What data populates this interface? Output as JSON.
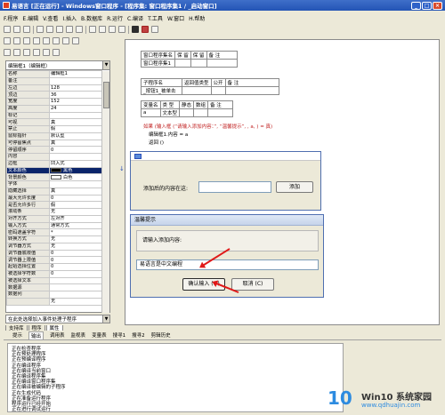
{
  "window": {
    "title": "易语言 [正在运行] - Windows窗口程序 - [程序集: 窗口程序集1 / _启动窗口]"
  },
  "menu": [
    "F.程序",
    "E.编辑",
    "V.查看",
    "I.插入",
    "B.数据库",
    "R.运行",
    "C.编译",
    "T.工具",
    "W.窗口",
    "H.帮助"
  ],
  "properties": {
    "combo": "编辑框1（编辑框）",
    "rows": [
      {
        "k": "名称",
        "v": "编辑框1"
      },
      {
        "k": "备注",
        "v": ""
      },
      {
        "k": "左边",
        "v": "128"
      },
      {
        "k": "顶边",
        "v": "36"
      },
      {
        "k": "宽度",
        "v": "152"
      },
      {
        "k": "高度",
        "v": "24"
      },
      {
        "k": "标记",
        "v": ""
      },
      {
        "k": "可视",
        "v": "真"
      },
      {
        "k": "禁止",
        "v": "假"
      },
      {
        "k": "鼠标指针",
        "v": "默认型"
      },
      {
        "k": "可停留焦点",
        "v": "真"
      },
      {
        "k": "停留顺序",
        "v": "0"
      },
      {
        "k": "内容",
        "v": ""
      },
      {
        "k": "边框",
        "v": "凹入式"
      },
      {
        "k": "文本颜色",
        "v": "黑色",
        "color": "#000000"
      },
      {
        "k": "背景颜色",
        "v": "白色",
        "color": "#ffffff"
      },
      {
        "k": "字体",
        "v": ""
      },
      {
        "k": "隐藏选择",
        "v": "真"
      },
      {
        "k": "最大允许长度",
        "v": "0"
      },
      {
        "k": "是否允许多行",
        "v": "假"
      },
      {
        "k": "滚动条",
        "v": "无"
      },
      {
        "k": "对齐方式",
        "v": "左对齐"
      },
      {
        "k": "输入方式",
        "v": "通常方式"
      },
      {
        "k": "密码遮盖字符",
        "v": "*"
      },
      {
        "k": "转换方式",
        "v": "无"
      },
      {
        "k": "调节器方式",
        "v": "无"
      },
      {
        "k": "调节器底限值",
        "v": "0"
      },
      {
        "k": "调节器上限值",
        "v": "0"
      },
      {
        "k": "起始选择位置",
        "v": "0"
      },
      {
        "k": "被选择字符数",
        "v": "0"
      },
      {
        "k": "被选择文本",
        "v": ""
      },
      {
        "k": "数据源",
        "v": ""
      },
      {
        "k": "数据列",
        "v": ""
      },
      {
        "k": "",
        "v": "无"
      }
    ]
  },
  "event_combo": "在此处选择加入事件处理子程序",
  "left_tabs": [
    "支持库",
    "程序",
    "属性"
  ],
  "editor": {
    "assembly": {
      "headers": [
        "窗口程序集名",
        "保 留",
        "保 留",
        "备 注"
      ],
      "row": [
        "窗口程序集1",
        "",
        "",
        ""
      ]
    },
    "sub": {
      "headers": [
        "子程序名",
        "返回值类型",
        "公开",
        "备 注"
      ],
      "row": [
        "_按钮1_被单击",
        "",
        "",
        ""
      ]
    },
    "vars": {
      "headers": [
        "变量名",
        "类 型",
        "静态",
        "数组",
        "备 注"
      ],
      "row": [
        "a",
        "文本型",
        "",
        "",
        ""
      ]
    },
    "code": [
      "如果 (输入框 (“请输入添加内容：”, “温馨提示”, , a, ) = 真)",
      "编辑框1.内容 = a",
      "返回 ()"
    ]
  },
  "dialog1": {
    "label": "添加后的内容在这:",
    "button": "添加"
  },
  "dialog2": {
    "title": "温馨提示",
    "prompt": "请输入添加内容:",
    "input_value": "易语言是中文编程",
    "ok": "确认输入 (O)",
    "cancel": "取消 (C)"
  },
  "output_tabs": [
    "提示",
    "输出",
    "调用表",
    "监视表",
    "变量表",
    "搜寻1",
    "搜寻2",
    "剪辑历史"
  ],
  "output_lines": [
    "正在检查程序",
    "正在预处理程序",
    "正在预编译程序",
    "正在编译程序",
    "正在编译当前窗口",
    "正在编译程序集",
    "正在编译窗口程序集",
    "正在编译被编辑的子程序",
    "正在生成代码",
    "正在准备运行程序",
    "程序运行已经开始",
    "正在进行调试运行",
    "开始运行被调试程序"
  ],
  "watermark": {
    "logo": "10",
    "title": "Win10 系统家园",
    "url": "www.qdhuajin.com"
  }
}
